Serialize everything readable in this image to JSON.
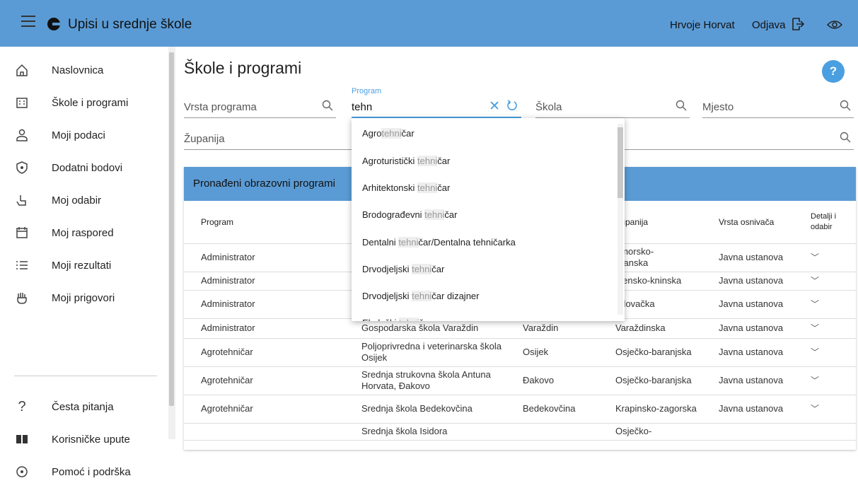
{
  "header": {
    "app_title": "Upisi u srednje škole",
    "user_name": "Hrvoje Horvat",
    "logout_label": "Odjava"
  },
  "sidebar": {
    "items": [
      {
        "label": "Naslovnica",
        "icon": "home-icon"
      },
      {
        "label": "Škole i programi",
        "icon": "building-icon"
      },
      {
        "label": "Moji podaci",
        "icon": "user-icon"
      },
      {
        "label": "Dodatni bodovi",
        "icon": "shield-star-icon"
      },
      {
        "label": "Moj odabir",
        "icon": "hand-pointer-icon"
      },
      {
        "label": "Moj raspored",
        "icon": "calendar-icon"
      },
      {
        "label": "Moji rezultati",
        "icon": "list-icon"
      },
      {
        "label": "Moji prigovori",
        "icon": "raised-hand-icon"
      },
      {
        "label": "Česta pitanja",
        "icon": "question-icon"
      },
      {
        "label": "Korisničke upute",
        "icon": "book-icon"
      },
      {
        "label": "Pomoć i podrška",
        "icon": "support-icon"
      }
    ]
  },
  "main": {
    "title": "Škole i programi",
    "help_label": "?",
    "filters": {
      "vrsta_programa": "Vrsta programa",
      "program_label": "Program",
      "program_value": "tehn",
      "skola": "Škola",
      "mjesto": "Mjesto",
      "zupanija": "Županija"
    },
    "results_title": "Pronađeni obrazovni programi",
    "columns": [
      "Program",
      "Županija",
      "Vrsta osnivača",
      "Detalji i odabir"
    ],
    "rows": [
      {
        "program": "Administrator",
        "skola": "",
        "mjesto": "",
        "zupanija": "rimorsko-\noranska",
        "vrsta": "Javna ustanova"
      },
      {
        "program": "Administrator",
        "skola": "",
        "mjesto": "",
        "zupanija": "ibensko-kninska",
        "vrsta": "Javna ustanova"
      },
      {
        "program": "Administrator",
        "skola": "",
        "mjesto": "",
        "zupanija": "arlovačka",
        "vrsta": "Javna ustanova"
      },
      {
        "program": "Administrator",
        "skola": "Gospodarska škola Varaždin",
        "mjesto": "Varaždin",
        "zupanija": "Varaždinska",
        "vrsta": "Javna ustanova"
      },
      {
        "program": "Agrotehničar",
        "skola": "Poljoprivredna i veterinarska škola Osijek",
        "mjesto": "Osijek",
        "zupanija": "Osječko-baranjska",
        "vrsta": "Javna ustanova"
      },
      {
        "program": "Agrotehničar",
        "skola": "Srednja strukovna škola Antuna Horvata, Đakovo",
        "mjesto": "Đakovo",
        "zupanija": "Osječko-baranjska",
        "vrsta": "Javna ustanova"
      },
      {
        "program": "Agrotehničar",
        "skola": "Srednja škola Bedekovčina",
        "mjesto": "Bedekovčina",
        "zupanija": "Krapinsko-zagorska",
        "vrsta": "Javna ustanova"
      },
      {
        "program": "",
        "skola": "Srednja škola Isidora",
        "mjesto": "",
        "zupanija": "Osječko-",
        "vrsta": ""
      }
    ],
    "dropdown": [
      {
        "pre": "Agro",
        "hl": "tehni",
        "post": "čar"
      },
      {
        "pre": "Agroturistički ",
        "hl": "tehni",
        "post": "čar"
      },
      {
        "pre": "Arhitektonski ",
        "hl": "tehni",
        "post": "čar"
      },
      {
        "pre": "Brodograđevni ",
        "hl": "tehni",
        "post": "čar"
      },
      {
        "pre": "Dentalni ",
        "hl": "tehni",
        "post": "čar/Dentalna tehničarka"
      },
      {
        "pre": "Drvodjeljski ",
        "hl": "tehni",
        "post": "čar"
      },
      {
        "pre": "Drvodjeljski ",
        "hl": "tehni",
        "post": "čar dizajner"
      },
      {
        "pre": "Ekološki ",
        "hl": "tehni",
        "post": "čar"
      }
    ]
  }
}
